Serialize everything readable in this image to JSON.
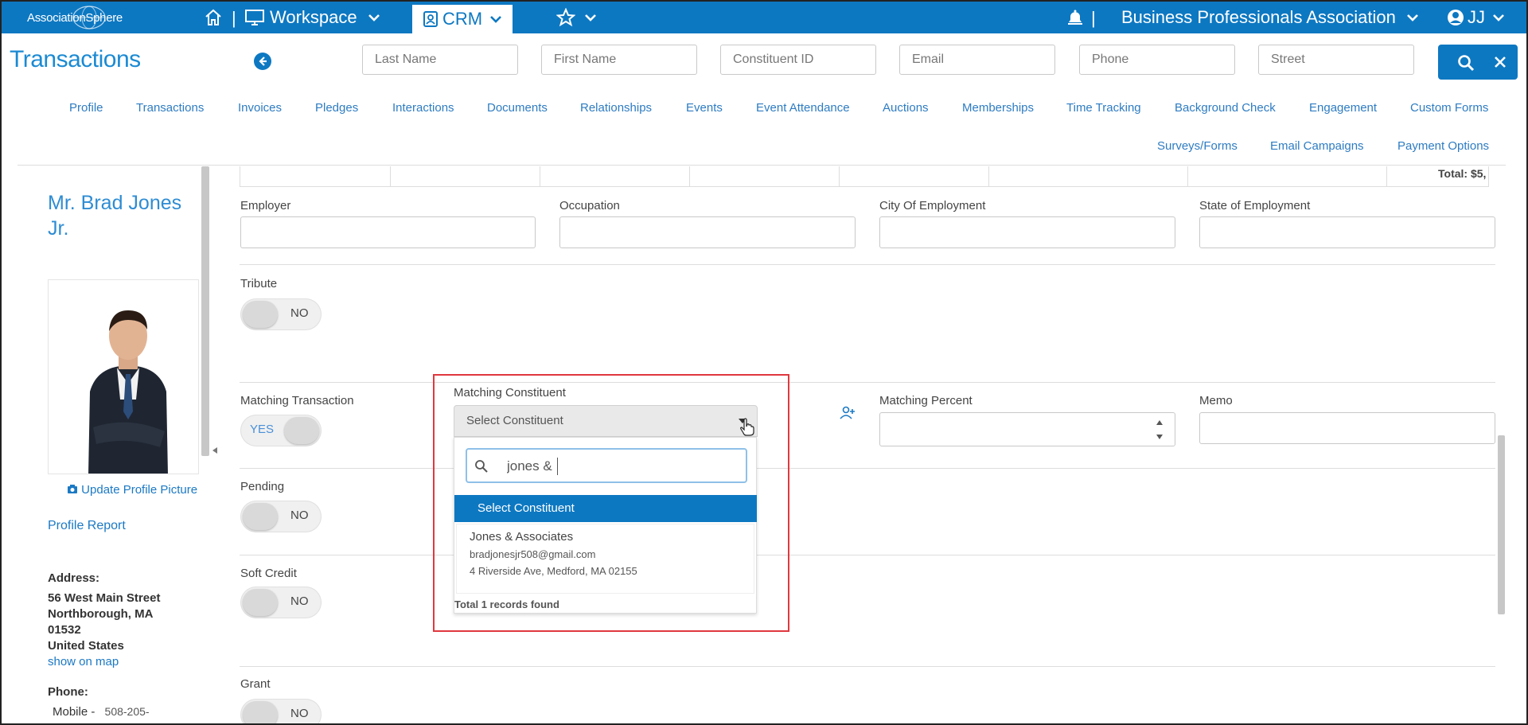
{
  "topbar": {
    "logo_text": "AssociationSphere",
    "workspace_label": "Workspace",
    "crm_label": "CRM",
    "org_name": "Business Professionals Association",
    "user_initials": "JJ",
    "separator": "|"
  },
  "header": {
    "title": "Transactions",
    "search_fields": {
      "last_name": "Last Name",
      "first_name": "First Name",
      "constituent_id": "Constituent ID",
      "email": "Email",
      "phone": "Phone",
      "street": "Street"
    }
  },
  "tabs": {
    "row1": [
      "Profile",
      "Transactions",
      "Invoices",
      "Pledges",
      "Interactions",
      "Documents",
      "Relationships",
      "Events",
      "Event Attendance",
      "Auctions",
      "Memberships",
      "Time Tracking",
      "Background Check",
      "Engagement",
      "Custom Forms"
    ],
    "row2": [
      "Surveys/Forms",
      "Email Campaigns",
      "Payment Options"
    ]
  },
  "profile": {
    "name": "Mr. Brad Jones Jr.",
    "update_picture": "Update Profile Picture",
    "profile_report": "Profile Report",
    "address_label": "Address:",
    "address_line1": "56 West Main Street",
    "address_line2": "Northborough, MA",
    "address_line3": "01532",
    "address_line4": "United States",
    "show_on_map": "show on map",
    "phone_label": "Phone:",
    "phone_type": "Mobile -",
    "phone_value": "508-205-"
  },
  "form": {
    "total_partial": "Total: $5,",
    "employer": "Employer",
    "occupation": "Occupation",
    "city_of_employment": "City Of Employment",
    "state_of_employment": "State of Employment",
    "tribute": "Tribute",
    "matching_transaction": "Matching Transaction",
    "matching_constituent": "Matching Constituent",
    "matching_percent": "Matching Percent",
    "memo": "Memo",
    "pending": "Pending",
    "soft_credit": "Soft Credit",
    "grant": "Grant",
    "toggle_no": "NO",
    "toggle_yes": "YES"
  },
  "dropdown": {
    "placeholder": "Select Constituent",
    "search_value": "jones & ",
    "selected_option": "Select Constituent",
    "result": {
      "name": "Jones & Associates",
      "email": "bradjonesjr508@gmail.com",
      "address": "4 Riverside Ave, Medford, MA 02155"
    },
    "total": "Total 1 records found"
  },
  "colors": {
    "brand": "#0d78c2",
    "link": "#2e7cc2",
    "highlight": "#e0383f"
  }
}
